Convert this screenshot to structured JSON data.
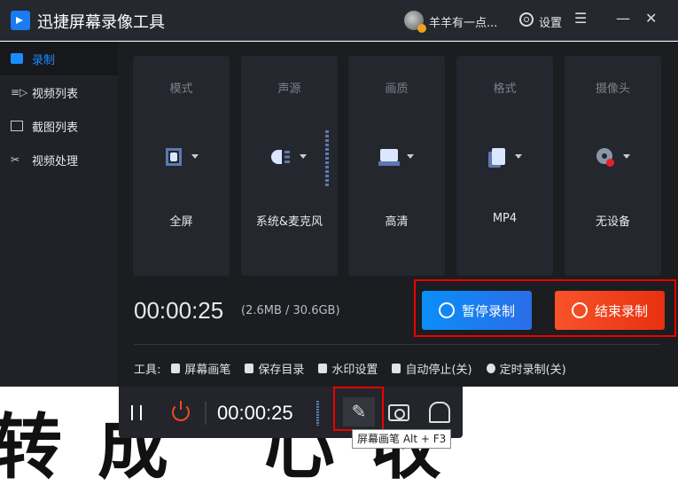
{
  "titlebar": {
    "title": "迅捷屏幕录像工具",
    "username": "羊羊有一点...",
    "settings": "设置",
    "menu_icon": "☰",
    "minimize_icon": "—",
    "close_icon": "✕"
  },
  "sidebar": {
    "items": [
      {
        "label": "录制",
        "icon": "camera-icon",
        "active": true
      },
      {
        "label": "视频列表",
        "icon": "video-list-icon"
      },
      {
        "label": "截图列表",
        "icon": "screenshot-list-icon"
      },
      {
        "label": "视频处理",
        "icon": "video-process-icon"
      }
    ]
  },
  "cards": [
    {
      "label": "模式",
      "value": "全屏"
    },
    {
      "label": "声源",
      "value": "系统&麦克风"
    },
    {
      "label": "画质",
      "value": "高清"
    },
    {
      "label": "格式",
      "value": "MP4"
    },
    {
      "label": "摄像头",
      "value": "无设备"
    }
  ],
  "status": {
    "timer": "00:00:25",
    "size": "(2.6MB / 30.6GB)"
  },
  "buttons": {
    "pause": "暂停录制",
    "stop": "结束录制"
  },
  "tools": {
    "label": "工具:",
    "items": [
      "屏幕画笔",
      "保存目录",
      "水印设置",
      "自动停止(关)",
      "定时录制(关)"
    ]
  },
  "float_bar": {
    "timer": "00:00:25",
    "pen_icon": "✎",
    "tooltip": "屏幕画笔 Alt + F3"
  },
  "background_text": "转成 心收"
}
